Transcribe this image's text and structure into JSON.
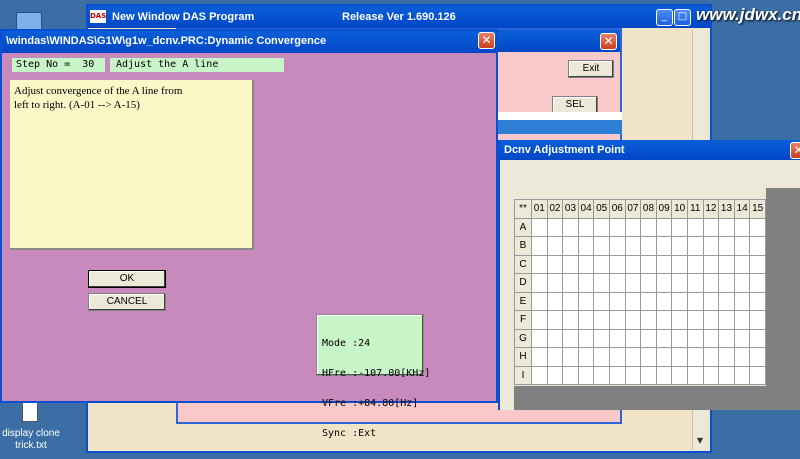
{
  "watermark": "www.jdwx.cn",
  "main_window": {
    "title": "New Window DAS Program",
    "version": "Release Ver 1.690.126",
    "logo": "DAS"
  },
  "pink_window": {
    "exit_label": "Exit",
    "sel_label": "SEL"
  },
  "dialog": {
    "title": "\\windas\\WINDAS\\G1W\\g1w_dcnv.PRC:Dynamic Convergence",
    "step_label": "Step No =  30",
    "step_desc": "Adjust the A line",
    "instructions_line1": "Adjust convergence of the A line from",
    "instructions_line2": "left to right. (A-01 --> A-15)",
    "ok_label": "OK",
    "cancel_label": "CANCEL",
    "mode_line": "Mode :24",
    "hfre_line": "HFre :-107.00[KHz]",
    "vfre_line": "VFre :+84.80[Hz]",
    "sync_line": "Sync :Ext"
  },
  "dcnv": {
    "title": "Dcnv Adjustment Point",
    "corner": "**",
    "columns": [
      "01",
      "02",
      "03",
      "04",
      "05",
      "06",
      "07",
      "08",
      "09",
      "10",
      "11",
      "12",
      "13",
      "14",
      "15"
    ],
    "rows": [
      "A",
      "B",
      "C",
      "D",
      "E",
      "F",
      "G",
      "H",
      "I"
    ]
  },
  "desktop": {
    "file_label_line1": "display clone",
    "file_label_line2": "trick.txt"
  },
  "colors": {
    "desktop": "#3a6ea5",
    "dialog_body": "#c88abd",
    "pink_panel": "#f9c8c8",
    "note_bg": "#fbf8c8",
    "status_bg": "#c8f5c8"
  }
}
